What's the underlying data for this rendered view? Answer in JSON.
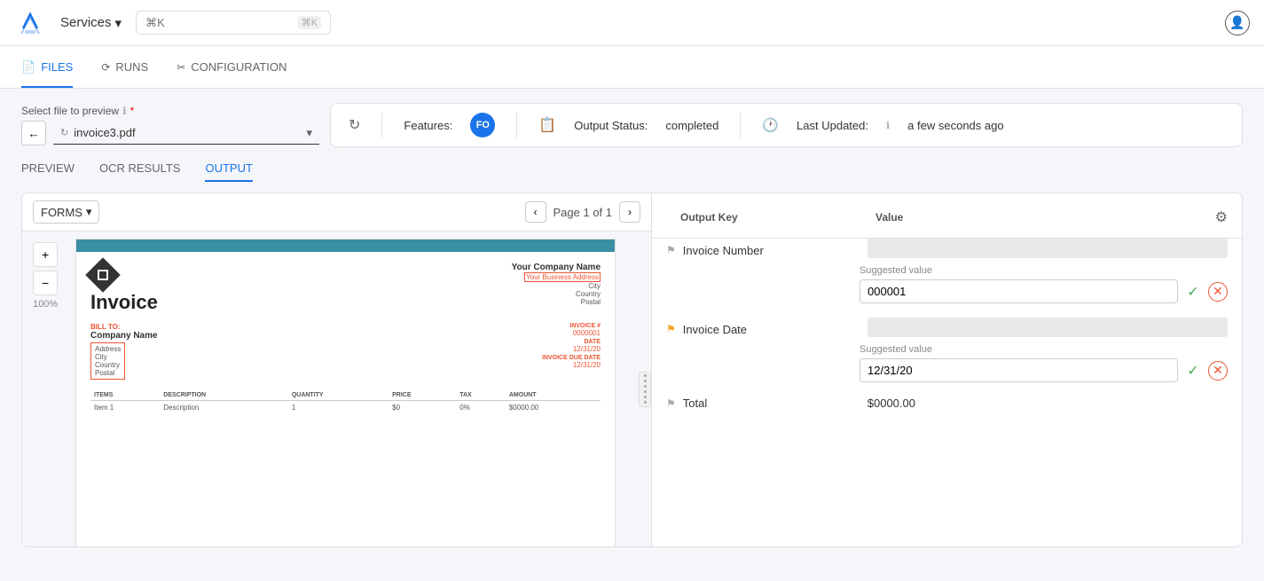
{
  "topnav": {
    "services_label": "Services",
    "search_placeholder": "⌘K",
    "user_icon_label": "user"
  },
  "tabs": [
    {
      "id": "files",
      "label": "FILES",
      "icon": "📄",
      "active": true
    },
    {
      "id": "runs",
      "label": "RUNS",
      "icon": "▶",
      "active": false
    },
    {
      "id": "configuration",
      "label": "CONFIGURATION",
      "icon": "⚙",
      "active": false
    }
  ],
  "file_selector": {
    "label": "Select file to preview",
    "required": true,
    "selected_file": "invoice3.pdf"
  },
  "status_bar": {
    "features_label": "Features:",
    "fo_badge": "FO",
    "output_status_label": "Output Status:",
    "output_status_value": "completed",
    "last_updated_label": "Last Updated:",
    "last_updated_value": "a few seconds ago"
  },
  "sub_tabs": [
    {
      "id": "preview",
      "label": "PREVIEW",
      "active": false
    },
    {
      "id": "ocr_results",
      "label": "OCR RESULTS",
      "active": false
    },
    {
      "id": "output",
      "label": "OUTPUT",
      "active": true
    }
  ],
  "preview_panel": {
    "forms_label": "FORMS",
    "page_label": "Page 1 of 1",
    "zoom_in": "+",
    "zoom_out": "−",
    "zoom_level": "100%",
    "invoice": {
      "company_name": "Your Company Name",
      "address_line": "Your Business Address",
      "city": "City",
      "country": "Country",
      "postal": "Postal",
      "title": "Invoice",
      "bill_to_label": "BILL TO:",
      "company": "Company Name",
      "address": "Address",
      "city2": "City",
      "country2": "Country",
      "postal2": "Postal",
      "invoice_num_label": "INVOICE #",
      "invoice_num": "0000001",
      "date_label": "DATE",
      "date_val": "12/31/20",
      "due_date_label": "INVOICE DUE DATE",
      "due_date_val": "12/31/20",
      "table_headers": [
        "ITEMS",
        "DESCRIPTION",
        "QUANTITY",
        "PRICE",
        "TAX",
        "AMOUNT"
      ],
      "table_rows": [
        {
          "item": "Item 1",
          "desc": "Description",
          "qty": "1",
          "price": "$0",
          "tax": "0%",
          "amount": "$0000.00"
        }
      ]
    }
  },
  "output_panel": {
    "col_key": "Output Key",
    "col_value": "Value",
    "items": [
      {
        "id": "invoice_number",
        "flag": "gray",
        "key": "Invoice Number",
        "suggested_label": "Suggested value",
        "input_value": "000001"
      },
      {
        "id": "invoice_date",
        "flag": "yellow",
        "key": "Invoice Date",
        "suggested_label": "Suggested value",
        "input_value": "12/31/20"
      },
      {
        "id": "total",
        "flag": "gray",
        "key": "Total",
        "static_value": "$0000.00"
      }
    ]
  }
}
